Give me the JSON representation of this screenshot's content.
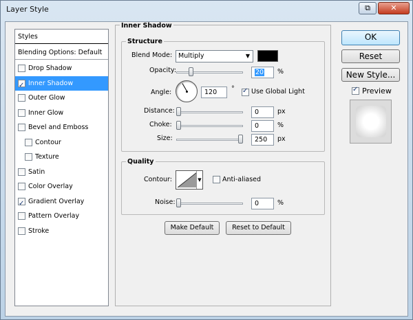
{
  "window": {
    "title": "Layer Style"
  },
  "styles_panel": {
    "header": "Styles",
    "blending": "Blending Options: Default",
    "items": [
      {
        "label": "Drop Shadow",
        "checked": false,
        "selected": false,
        "indent": false
      },
      {
        "label": "Inner Shadow",
        "checked": true,
        "selected": true,
        "indent": false
      },
      {
        "label": "Outer Glow",
        "checked": false,
        "selected": false,
        "indent": false
      },
      {
        "label": "Inner Glow",
        "checked": false,
        "selected": false,
        "indent": false
      },
      {
        "label": "Bevel and Emboss",
        "checked": false,
        "selected": false,
        "indent": false
      },
      {
        "label": "Contour",
        "checked": false,
        "selected": false,
        "indent": true
      },
      {
        "label": "Texture",
        "checked": false,
        "selected": false,
        "indent": true
      },
      {
        "label": "Satin",
        "checked": false,
        "selected": false,
        "indent": false
      },
      {
        "label": "Color Overlay",
        "checked": false,
        "selected": false,
        "indent": false
      },
      {
        "label": "Gradient Overlay",
        "checked": true,
        "selected": false,
        "indent": false
      },
      {
        "label": "Pattern Overlay",
        "checked": false,
        "selected": false,
        "indent": false
      },
      {
        "label": "Stroke",
        "checked": false,
        "selected": false,
        "indent": false
      }
    ]
  },
  "inner_shadow": {
    "title": "Inner Shadow",
    "structure": {
      "title": "Structure",
      "blend_mode_label": "Blend Mode:",
      "blend_mode": "Multiply",
      "shadow_color": "#000000",
      "opacity_label": "Opacity:",
      "opacity": "20",
      "opacity_unit": "%",
      "angle_label": "Angle:",
      "angle": "120",
      "angle_unit": "°",
      "use_global_light": "Use Global Light",
      "use_global_light_checked": true,
      "distance_label": "Distance:",
      "distance": "0",
      "distance_unit": "px",
      "choke_label": "Choke:",
      "choke": "0",
      "choke_unit": "%",
      "size_label": "Size:",
      "size": "250",
      "size_unit": "px"
    },
    "quality": {
      "title": "Quality",
      "contour_label": "Contour:",
      "anti_aliased": "Anti-aliased",
      "anti_aliased_checked": false,
      "noise_label": "Noise:",
      "noise": "0",
      "noise_unit": "%"
    },
    "make_default": "Make Default",
    "reset_to_default": "Reset to Default"
  },
  "actions": {
    "ok": "OK",
    "reset": "Reset",
    "new_style": "New Style...",
    "preview": "Preview",
    "preview_checked": true
  },
  "sliders": {
    "opacity_fraction": 0.2,
    "distance_fraction": 0.0,
    "choke_fraction": 0.0,
    "size_fraction": 1.0,
    "noise_fraction": 0.0
  }
}
